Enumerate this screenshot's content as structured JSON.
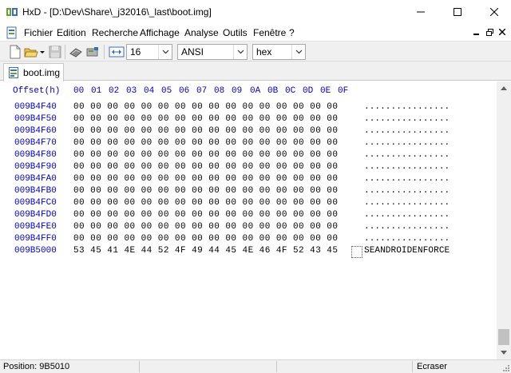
{
  "window": {
    "title": "HxD - [D:\\Dev\\Share\\_j32016\\_last\\boot.img]"
  },
  "menu": {
    "items": [
      "Fichier",
      "Edition",
      "Recherche",
      "Affichage",
      "Analyse",
      "Outils",
      "Fenêtre",
      "?"
    ]
  },
  "toolbar": {
    "bytes_per_row": "16",
    "charset": "ANSI",
    "offset_base": "hex"
  },
  "tab": {
    "label": "boot.img"
  },
  "hex": {
    "header_label": "Offset(h)",
    "columns": [
      "00",
      "01",
      "02",
      "03",
      "04",
      "05",
      "06",
      "07",
      "08",
      "09",
      "0A",
      "0B",
      "0C",
      "0D",
      "0E",
      "0F"
    ],
    "rows": [
      {
        "offset": "009B4F40",
        "bytes": "00 00 00 00 00 00 00 00 00 00 00 00 00 00 00 00",
        "ascii": "................"
      },
      {
        "offset": "009B4F50",
        "bytes": "00 00 00 00 00 00 00 00 00 00 00 00 00 00 00 00",
        "ascii": "................"
      },
      {
        "offset": "009B4F60",
        "bytes": "00 00 00 00 00 00 00 00 00 00 00 00 00 00 00 00",
        "ascii": "................"
      },
      {
        "offset": "009B4F70",
        "bytes": "00 00 00 00 00 00 00 00 00 00 00 00 00 00 00 00",
        "ascii": "................"
      },
      {
        "offset": "009B4F80",
        "bytes": "00 00 00 00 00 00 00 00 00 00 00 00 00 00 00 00",
        "ascii": "................"
      },
      {
        "offset": "009B4F90",
        "bytes": "00 00 00 00 00 00 00 00 00 00 00 00 00 00 00 00",
        "ascii": "................"
      },
      {
        "offset": "009B4FA0",
        "bytes": "00 00 00 00 00 00 00 00 00 00 00 00 00 00 00 00",
        "ascii": "................"
      },
      {
        "offset": "009B4FB0",
        "bytes": "00 00 00 00 00 00 00 00 00 00 00 00 00 00 00 00",
        "ascii": "................"
      },
      {
        "offset": "009B4FC0",
        "bytes": "00 00 00 00 00 00 00 00 00 00 00 00 00 00 00 00",
        "ascii": "................"
      },
      {
        "offset": "009B4FD0",
        "bytes": "00 00 00 00 00 00 00 00 00 00 00 00 00 00 00 00",
        "ascii": "................"
      },
      {
        "offset": "009B4FE0",
        "bytes": "00 00 00 00 00 00 00 00 00 00 00 00 00 00 00 00",
        "ascii": "................"
      },
      {
        "offset": "009B4FF0",
        "bytes": "00 00 00 00 00 00 00 00 00 00 00 00 00 00 00 00",
        "ascii": "................"
      },
      {
        "offset": "009B5000",
        "bytes": "53 45 41 4E 44 52 4F 49 44 45 4E 46 4F 52 43 45",
        "ascii": "SEANDROIDENFORCE"
      }
    ]
  },
  "status": {
    "position": "Position: 9B5010",
    "mode": "Ecraser"
  },
  "colors": {
    "offset_blue": "#0000cc",
    "toolbar_bg": "#f0f0f0"
  }
}
